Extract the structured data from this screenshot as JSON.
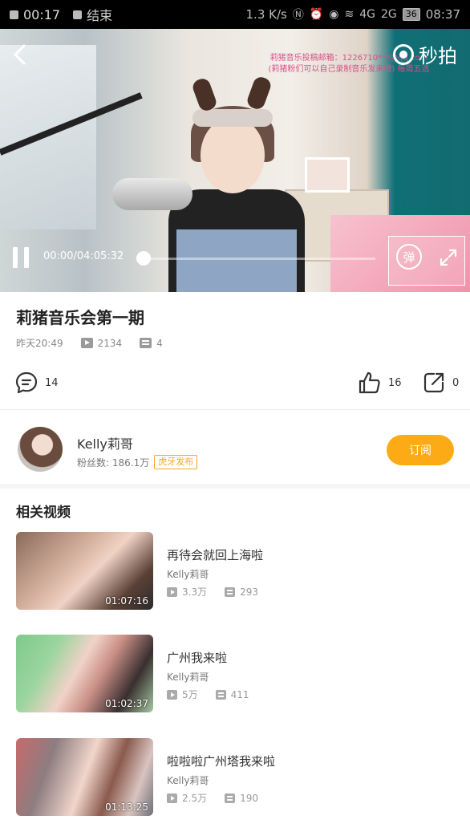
{
  "status_bar": {
    "time": "00:17",
    "notification": "结束",
    "speed": "1.3 K/s",
    "network_4g": "4G",
    "network_2g": "2G",
    "battery": "36",
    "clock": "08:37"
  },
  "video": {
    "watermark": "秒拍",
    "overlay_line1": "莉猪音乐投稿邮箱：1226710***@qq.com",
    "overlay_line2": "(莉猪粉们可以自己录制音乐发来哦) 每周五选",
    "current_time": "00:00",
    "total_time": "04:05:32",
    "progress": 0.0,
    "danmu_label": "弹"
  },
  "title": "莉猪音乐会第一期",
  "meta": {
    "date": "昨天20:49",
    "plays": "2134",
    "comments_count": "4"
  },
  "actions": {
    "comments": "14",
    "likes": "16",
    "shares": "0"
  },
  "author": {
    "name": "Kelly莉哥",
    "fans_label": "粉丝数: 186.1万",
    "badge": "虎牙发布",
    "subscribe": "订阅"
  },
  "related": {
    "title": "相关视频",
    "items": [
      {
        "title": "再待会就回上海啦",
        "author": "Kelly莉哥",
        "duration": "01:07:16",
        "plays": "3.3万",
        "comments": "293"
      },
      {
        "title": "广州我来啦",
        "author": "Kelly莉哥",
        "duration": "01:02:37",
        "plays": "5万",
        "comments": "411"
      },
      {
        "title": "啦啦啦广州塔我来啦",
        "author": "Kelly莉哥",
        "duration": "01:13:25",
        "plays": "2.5万",
        "comments": "190"
      }
    ]
  },
  "icons": {
    "back": "back-arrow-icon",
    "pause": "pause-icon",
    "fullscreen": "fullscreen-icon",
    "comment": "comment-icon",
    "like": "thumbs-up-icon",
    "share": "share-icon",
    "play_count": "play-count-icon",
    "comment_count": "comment-count-icon"
  },
  "colors": {
    "accent": "#fcab16",
    "badge": "#f6a623"
  }
}
